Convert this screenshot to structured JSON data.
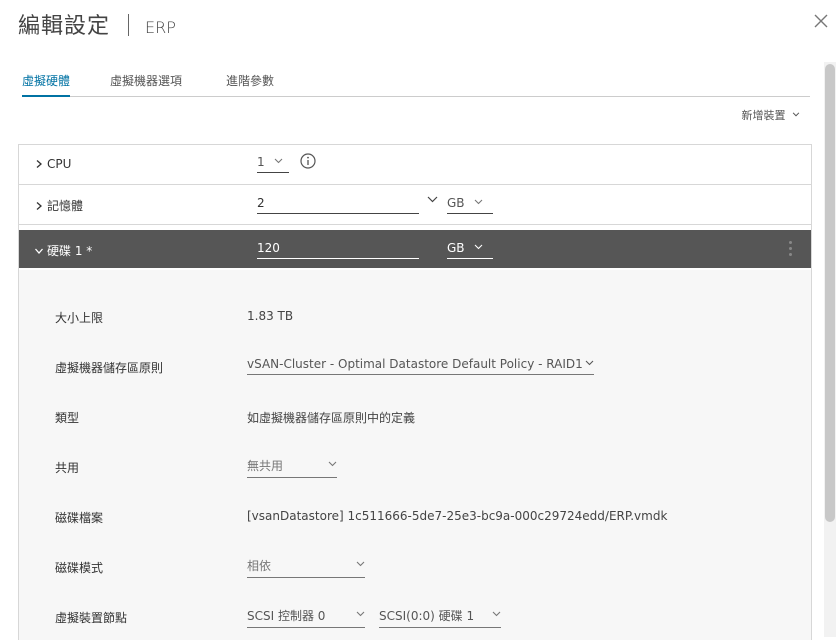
{
  "header": {
    "title": "編輯設定",
    "vm_name": "ERP"
  },
  "tabs": [
    {
      "label": "虛擬硬體",
      "active": true
    },
    {
      "label": "虛擬機器選項",
      "active": false
    },
    {
      "label": "進階參數",
      "active": false
    }
  ],
  "toolbar": {
    "add_device_label": "新增裝置"
  },
  "hardware": {
    "cpu": {
      "label": "CPU",
      "value": "1"
    },
    "memory": {
      "label": "記憶體",
      "value": "2",
      "unit": "GB"
    },
    "disk1": {
      "label": "硬碟 1 *",
      "value": "120",
      "unit": "GB",
      "details": {
        "max_size": {
          "label": "大小上限",
          "value": "1.83 TB"
        },
        "storage_policy": {
          "label": "虛擬機器儲存區原則",
          "value": "vSAN-Cluster - Optimal Datastore Default Policy - RAID1"
        },
        "type": {
          "label": "類型",
          "value": "如虛擬機器儲存區原則中的定義"
        },
        "sharing": {
          "label": "共用",
          "value": "無共用"
        },
        "disk_file": {
          "label": "磁碟檔案",
          "value": "[vsanDatastore] 1c511666-5de7-25e3-bc9a-000c29724edd/ERP.vmdk"
        },
        "disk_mode": {
          "label": "磁碟模式",
          "value": "相依"
        },
        "virtual_device_node": {
          "label": "虛擬裝置節點",
          "controller": "SCSI 控制器 0",
          "node": "SCSI(0:0) 硬碟 1"
        }
      }
    }
  },
  "colors": {
    "accent": "#0072a3",
    "dark_row": "#565656"
  }
}
